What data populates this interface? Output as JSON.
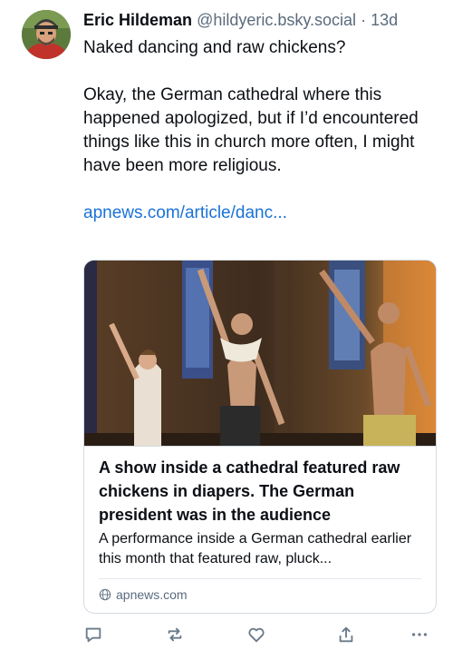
{
  "post": {
    "author": {
      "display_name": "Eric Hildeman",
      "handle": "@hildyeric.bsky.social",
      "separator": "·",
      "time_ago": "13d"
    },
    "text": {
      "line1": "Naked dancing and raw chickens?",
      "line2": "Okay, the German cathedral where this happened apologized, but if I’d encountered things like this in church more often, I might have been more religious.",
      "link": "apnews.com/article/danc..."
    },
    "link_card": {
      "title": "A show inside a cathedral featured raw chickens in diapers. The German president was in the audience",
      "description": "A performance inside a German cathedral earlier this month that featured raw, pluck...",
      "domain": "apnews.com"
    },
    "actions": [
      {
        "name": "reply-icon"
      },
      {
        "name": "repost-icon"
      },
      {
        "name": "like-icon"
      },
      {
        "name": "share-icon"
      },
      {
        "name": "more-icon"
      }
    ]
  }
}
